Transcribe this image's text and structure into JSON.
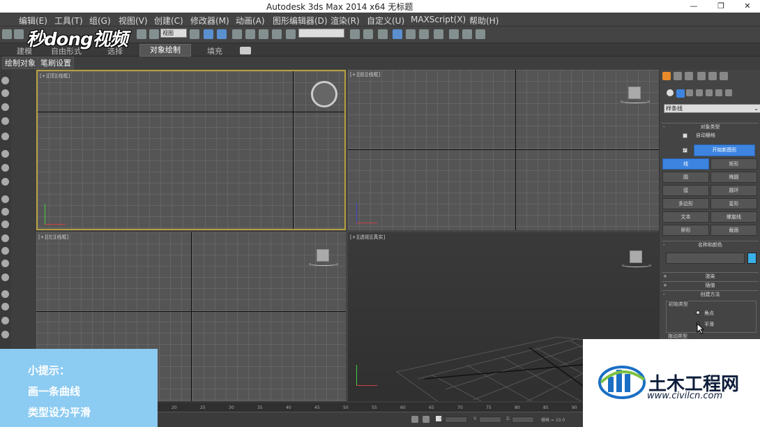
{
  "window": {
    "title": "Autodesk 3ds Max  2014 x64      无标题",
    "minimize_icon": "minimize-icon",
    "restore_icon": "restore-icon",
    "close_icon": "close-icon"
  },
  "menu": [
    "编辑(E)",
    "工具(T)",
    "组(G)",
    "视图(V)",
    "创建(C)",
    "修改器(M)",
    "动画(A)",
    "图形编辑器(D)",
    "渲染(R)",
    "自定义(U)",
    "MAXScript(X)",
    "帮助(H)"
  ],
  "toolbar": {
    "view_select": "视图"
  },
  "ribbon_tabs": [
    "建模",
    "自由形式",
    "选择",
    "对象绘制",
    "填充"
  ],
  "ribbon_active": "对象绘制",
  "subbar": [
    "绘制对象",
    "笔刷设置"
  ],
  "viewports": [
    {
      "label": "[+][顶][线框]"
    },
    {
      "label": "[+][前][线框]"
    },
    {
      "label": "[+][左][线框]"
    },
    {
      "label": "[+][透视][真实]"
    }
  ],
  "command_panel": {
    "category_dropdown": "样条线",
    "object_type_header": "对象类型",
    "auto_grid": "自动栅格",
    "start_new_shape": "开始新图形",
    "buttons": [
      "线",
      "矩形",
      "圆",
      "椭圆",
      "弧",
      "圆环",
      "多边形",
      "星形",
      "文本",
      "螺旋线",
      "卵形",
      "截面"
    ],
    "active_button": "线",
    "name_color_header": "名称和颜色",
    "swatch_color": "#3ab0e8",
    "rendering_header": "渲染",
    "interpolation_header": "插值",
    "creation_method_header": "创建方法",
    "initial_type_label": "初始类型",
    "radio_corner": "角点",
    "radio_smooth": "平滑",
    "drag_type_label": "拖动类型"
  },
  "overlay_tip": {
    "line1": "小提示：",
    "line2": "画一条曲线",
    "line3": "类型设为平滑"
  },
  "watermark_top": "秒dong视频",
  "watermark_bottom": {
    "name": "土木工程网",
    "url": "www.civilcn.com"
  },
  "timeline": {
    "ticks": [
      "20",
      "25",
      "30",
      "35",
      "40",
      "45",
      "50",
      "55",
      "60",
      "65",
      "70",
      "75",
      "80",
      "85",
      "90"
    ],
    "x_label": "X:",
    "y_label": "Y:",
    "z_label": "Z:",
    "grid_label": "栅格 = 10.0"
  }
}
